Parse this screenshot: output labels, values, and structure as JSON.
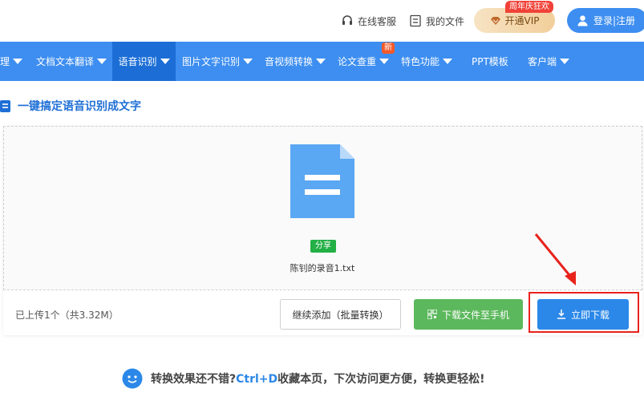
{
  "header": {
    "service_label": "在线客服",
    "my_files_label": "我的文件",
    "vip_tag": "周年庆狂欢",
    "vip_label": "开通VIP",
    "login_label": "登录|注册"
  },
  "nav": {
    "items": [
      {
        "label": "理"
      },
      {
        "label": "文档文本翻译"
      },
      {
        "label": "语音识别"
      },
      {
        "label": "图片文字识别"
      },
      {
        "label": "音视频转换"
      },
      {
        "label": "论文查重"
      },
      {
        "label": "特色功能"
      },
      {
        "label": "PPT模板"
      },
      {
        "label": "客户端"
      }
    ],
    "new_badge": "新"
  },
  "section": {
    "title": "一键搞定语音识别成文字"
  },
  "upload": {
    "share_label": "分享",
    "file_name": "陈钊的录音1.txt",
    "count_text": "已上传1个（共3.32M）",
    "add_more_label": "继续添加（批量转换）",
    "phone_label": "下载文件至手机",
    "download_label": "立即下载"
  },
  "tip": {
    "prefix": "转换效果还不错?",
    "hotkey": "Ctrl+D",
    "suffix": "收藏本页，下次访问更方便，转换更轻松!"
  },
  "colors": {
    "nav_bg": "#3d8ef0",
    "nav_active": "#1c6ed6",
    "download": "#2b88e8",
    "phone": "#5cb85c",
    "highlight": "#e8231c"
  }
}
